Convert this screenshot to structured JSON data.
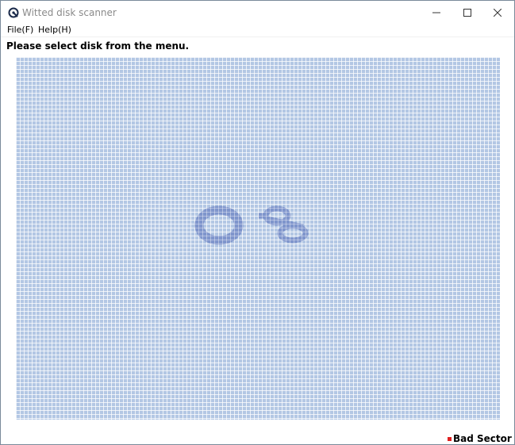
{
  "window": {
    "title": "Witted disk scanner"
  },
  "menu": {
    "items": [
      {
        "label": "File(F)"
      },
      {
        "label": "Help(H)"
      }
    ]
  },
  "status": {
    "message": "Please select disk from the menu."
  },
  "disk_map": {
    "cell_color": "#b3c7e4",
    "logo_color": "#5a6fb0"
  },
  "legend": {
    "bad_sector_label": "Bad Sector",
    "bad_sector_color": "#e02020"
  },
  "icons": {
    "app": "app-icon",
    "minimize": "minimize-icon",
    "maximize": "maximize-icon",
    "close": "close-icon"
  }
}
